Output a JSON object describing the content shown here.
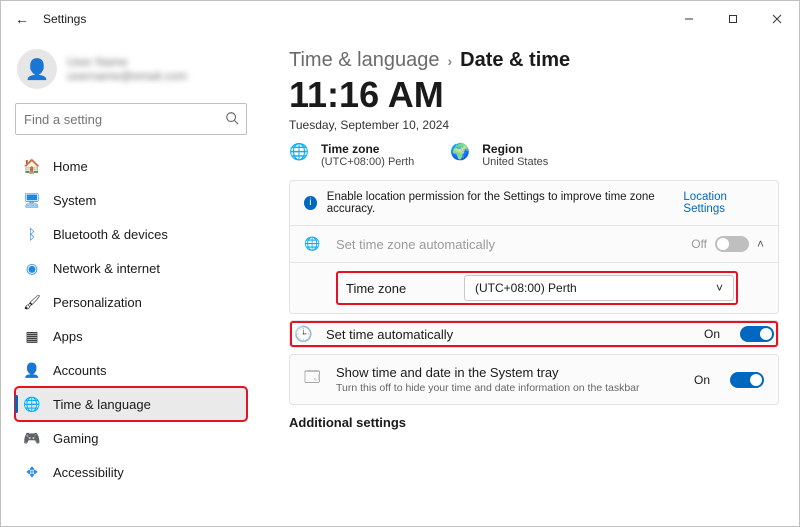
{
  "window": {
    "title": "Settings"
  },
  "profile": {
    "name": "User Name",
    "email": "username@email.com"
  },
  "search": {
    "placeholder": "Find a setting"
  },
  "sidebar": {
    "items": [
      {
        "label": "Home",
        "icon": "🏠",
        "color": "#4cc2ff"
      },
      {
        "label": "System",
        "icon": "🖥",
        "color": "#1e88e5"
      },
      {
        "label": "Bluetooth & devices",
        "icon": "ᚼ",
        "color": "#1e88e5"
      },
      {
        "label": "Network & internet",
        "icon": "📶",
        "color": "#1e88e5"
      },
      {
        "label": "Personalization",
        "icon": "🖌",
        "color": "#555"
      },
      {
        "label": "Apps",
        "icon": "▦",
        "color": "#555"
      },
      {
        "label": "Accounts",
        "icon": "👤",
        "color": "#555"
      },
      {
        "label": "Time & language",
        "icon": "🌐",
        "color": "#1e88e5"
      },
      {
        "label": "Gaming",
        "icon": "🎮",
        "color": "#777"
      },
      {
        "label": "Accessibility",
        "icon": "✥",
        "color": "#1e88e5"
      }
    ]
  },
  "crumbs": {
    "parent": "Time & language",
    "sep": "›",
    "current": "Date & time"
  },
  "clock": {
    "time": "11:16 AM",
    "date": "Tuesday, September 10, 2024"
  },
  "summary": {
    "tz_label": "Time zone",
    "tz_value": "(UTC+08:00) Perth",
    "region_label": "Region",
    "region_value": "United States"
  },
  "infobar": {
    "msg": "Enable location permission for the Settings to improve time zone accuracy.",
    "link": "Location Settings"
  },
  "rows": {
    "auto_tz": {
      "label": "Set time zone automatically",
      "state": "Off"
    },
    "tz_row": {
      "label": "Time zone",
      "value": "(UTC+08:00) Perth"
    },
    "auto_time": {
      "label": "Set time automatically",
      "state": "On"
    },
    "tray": {
      "label": "Show time and date in the System tray",
      "sub": "Turn this off to hide your time and date information on the taskbar",
      "state": "On"
    }
  },
  "sections": {
    "additional": "Additional settings"
  }
}
